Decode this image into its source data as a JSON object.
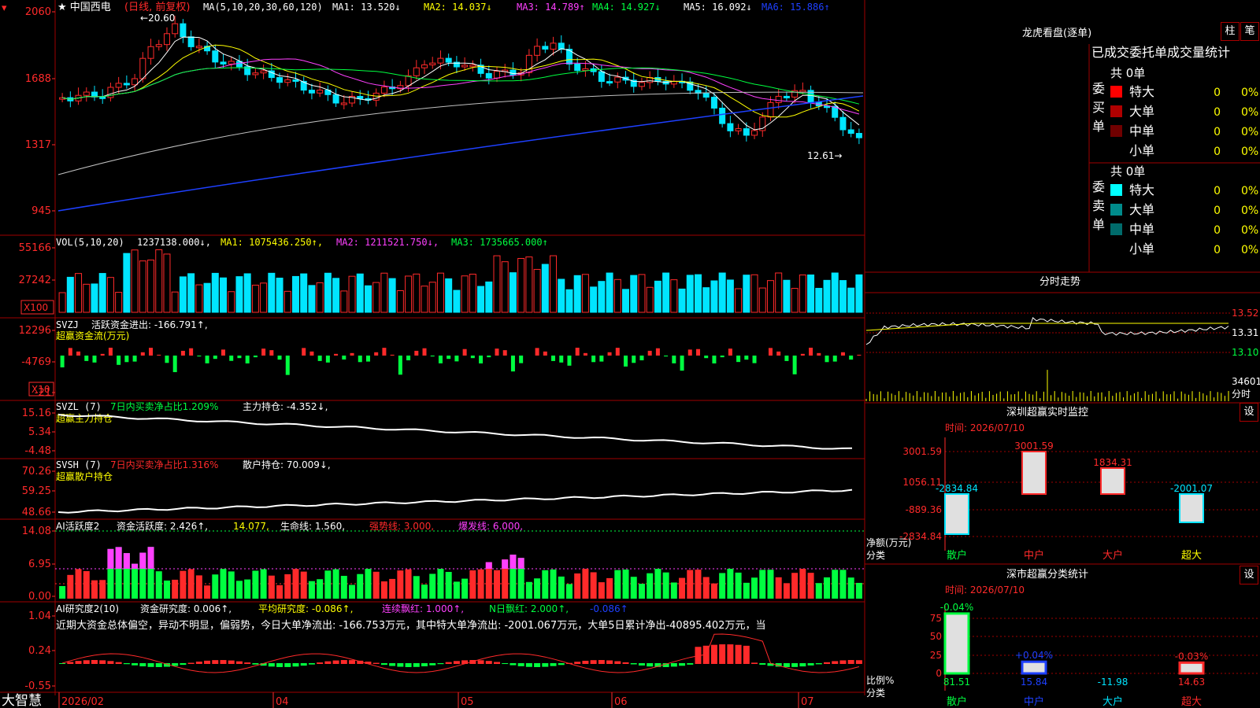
{
  "app": {
    "brand": "大智慧"
  },
  "colors": {
    "up": "#ff2a2a",
    "down": "#00e5ff",
    "grid": "#a00000",
    "ma1": "#ffffff",
    "ma2": "#ffff00",
    "ma3": "#ff40ff",
    "ma4": "#00ff40",
    "ma5": "#c0c0c0",
    "ma6": "#1e40ff",
    "vol_ma1": "#ffff00",
    "vol_ma2": "#ff40ff",
    "vol_ma3": "#00ff40"
  },
  "main": {
    "stock_name": "中国西电",
    "period_label": "(日线, 前复权)",
    "ma_header": "MA(5,10,20,30,60,120)",
    "ma_values": [
      {
        "label": "MA1: 13.520↓",
        "color": "#ffffff"
      },
      {
        "label": "MA2: 14.037↓",
        "color": "#ffff00"
      },
      {
        "label": "MA3: 14.789↑",
        "color": "#ff40ff"
      },
      {
        "label": "MA4: 14.927↓",
        "color": "#00ff40"
      },
      {
        "label": "MA5: 16.092↓",
        "color": "#ffffff"
      },
      {
        "label": "MA6: 15.886↑",
        "color": "#1e40ff"
      }
    ],
    "y_ticks": [
      "2060",
      "1688",
      "1317",
      "945"
    ],
    "high_label": "20.60",
    "low_label": "12.61"
  },
  "volume": {
    "header": "VOL(5,10,20)",
    "value": "1237138.000↓,",
    "ma1": "MA1: 1075436.250↑,",
    "ma2": "MA2: 1211521.750↓,",
    "ma3": "MA3: 1735665.000↑",
    "y_ticks": [
      "55166",
      "27242"
    ],
    "unit": "X100"
  },
  "svzj": {
    "header": "SVZJ",
    "label": "活跃资金进出: -166.791↑,",
    "sub": "超赢资金流(万元)",
    "y_ticks": [
      "12296",
      "-4769",
      "-21"
    ],
    "unit": "X10"
  },
  "svzl": {
    "header": "SVZL (7)",
    "ratio": "7日内买卖净占比1.209%",
    "holding": "主力持仓: -4.352↓,",
    "sub": "超赢主力持仓",
    "y_ticks": [
      "15.16",
      "5.34",
      "-4.48"
    ]
  },
  "svsh": {
    "header": "SVSH (7)",
    "ratio": "7日内买卖净占比1.316%",
    "holding": "散户持仓: 70.009↓,",
    "sub": "超赢散户持仓",
    "y_ticks": [
      "70.26",
      "59.25",
      "48.66"
    ]
  },
  "ai1": {
    "header": "AI活跃度2",
    "activity": "资金活跃度: 2.426↑,",
    "val2": "14.077,",
    "life": "生命线: 1.560,",
    "strong": "强势线: 3.000,",
    "burst": "爆发线: 6.000,",
    "y_ticks": [
      "14.08",
      "6.95",
      "0.00"
    ]
  },
  "ai2": {
    "header": "AI研究度2(10)",
    "research": "资金研究度: 0.006↑,",
    "avg": "平均研究度: -0.086↑,",
    "streak": "连续飘红: 1.000↑,",
    "nday": "N日飘红: 2.000↑,",
    "neg": "-0.086↑",
    "commentary": "近期大资金总体偏空，异动不明显，偏弱势，今日大单净流出: -166.753万元，其中特大单净流出: -2001.067万元，大单5日累计净出-40895.402万元，当",
    "y_ticks": [
      "1.04",
      "0.24",
      "-0.55"
    ]
  },
  "x_axis": [
    "2026/02",
    "04",
    "05",
    "06",
    "07"
  ],
  "right": {
    "lhb_title": "龙虎看盘(逐单)",
    "btn_zhu": "柱",
    "btn_bi": "笔",
    "order_title": "已成交委托单成交量统计",
    "buy_side": {
      "label": "委买单",
      "total": "共 0单",
      "rows": [
        {
          "name": "特大",
          "count": "0",
          "pct": "0%",
          "color": "#ff0000"
        },
        {
          "name": "大单",
          "count": "0",
          "pct": "0%",
          "color": "#b00000"
        },
        {
          "name": "中单",
          "count": "0",
          "pct": "0%",
          "color": "#700000"
        },
        {
          "name": "小单",
          "count": "0",
          "pct": "0%",
          "color": ""
        }
      ]
    },
    "sell_side": {
      "label": "委卖单",
      "total": "共 0单",
      "rows": [
        {
          "name": "特大",
          "count": "0",
          "pct": "0%",
          "color": "#00ffff"
        },
        {
          "name": "大单",
          "count": "0",
          "pct": "0%",
          "color": "#008b8b"
        },
        {
          "name": "中单",
          "count": "0",
          "pct": "0%",
          "color": "#006b6b"
        },
        {
          "name": "小单",
          "count": "0",
          "pct": "0%",
          "color": ""
        }
      ]
    },
    "intraday": {
      "title": "分时走势",
      "prices": [
        "13.52",
        "13.31",
        "13.10"
      ],
      "vol_top": "34601",
      "vol_bottom": "分时"
    },
    "monitor": {
      "title": "深圳超赢实时监控",
      "btn": "设",
      "time": "时间: 2026/07/10",
      "y_ticks": [
        "3001.59",
        "1056.11",
        "-889.36",
        "-2834.84"
      ],
      "ylabel": "净额(万元)",
      "xlabel": "分类",
      "categories": [
        "散户",
        "中户",
        "大户",
        "超大"
      ],
      "values": [
        -2834.84,
        3001.59,
        1834.31,
        -2001.07
      ],
      "value_labels": [
        "-2834.84",
        "3001.59",
        "1834.31",
        "-2001.07"
      ]
    },
    "classify": {
      "title": "深市超赢分类统计",
      "btn": "设",
      "time": "时间: 2026/07/10",
      "y_ticks": [
        "75",
        "50",
        "25",
        "0"
      ],
      "ylabel": "比例%",
      "xlabel": "分类",
      "categories": [
        "散户",
        "中户",
        "大户",
        "超大"
      ],
      "top_labels": [
        "-0.04%",
        "+0.04%",
        "",
        "-0.03%"
      ],
      "bottom_labels": [
        "81.51",
        "15.84",
        "-11.98",
        "14.63"
      ],
      "values": [
        81.51,
        15.84,
        0,
        14.63
      ]
    }
  }
}
